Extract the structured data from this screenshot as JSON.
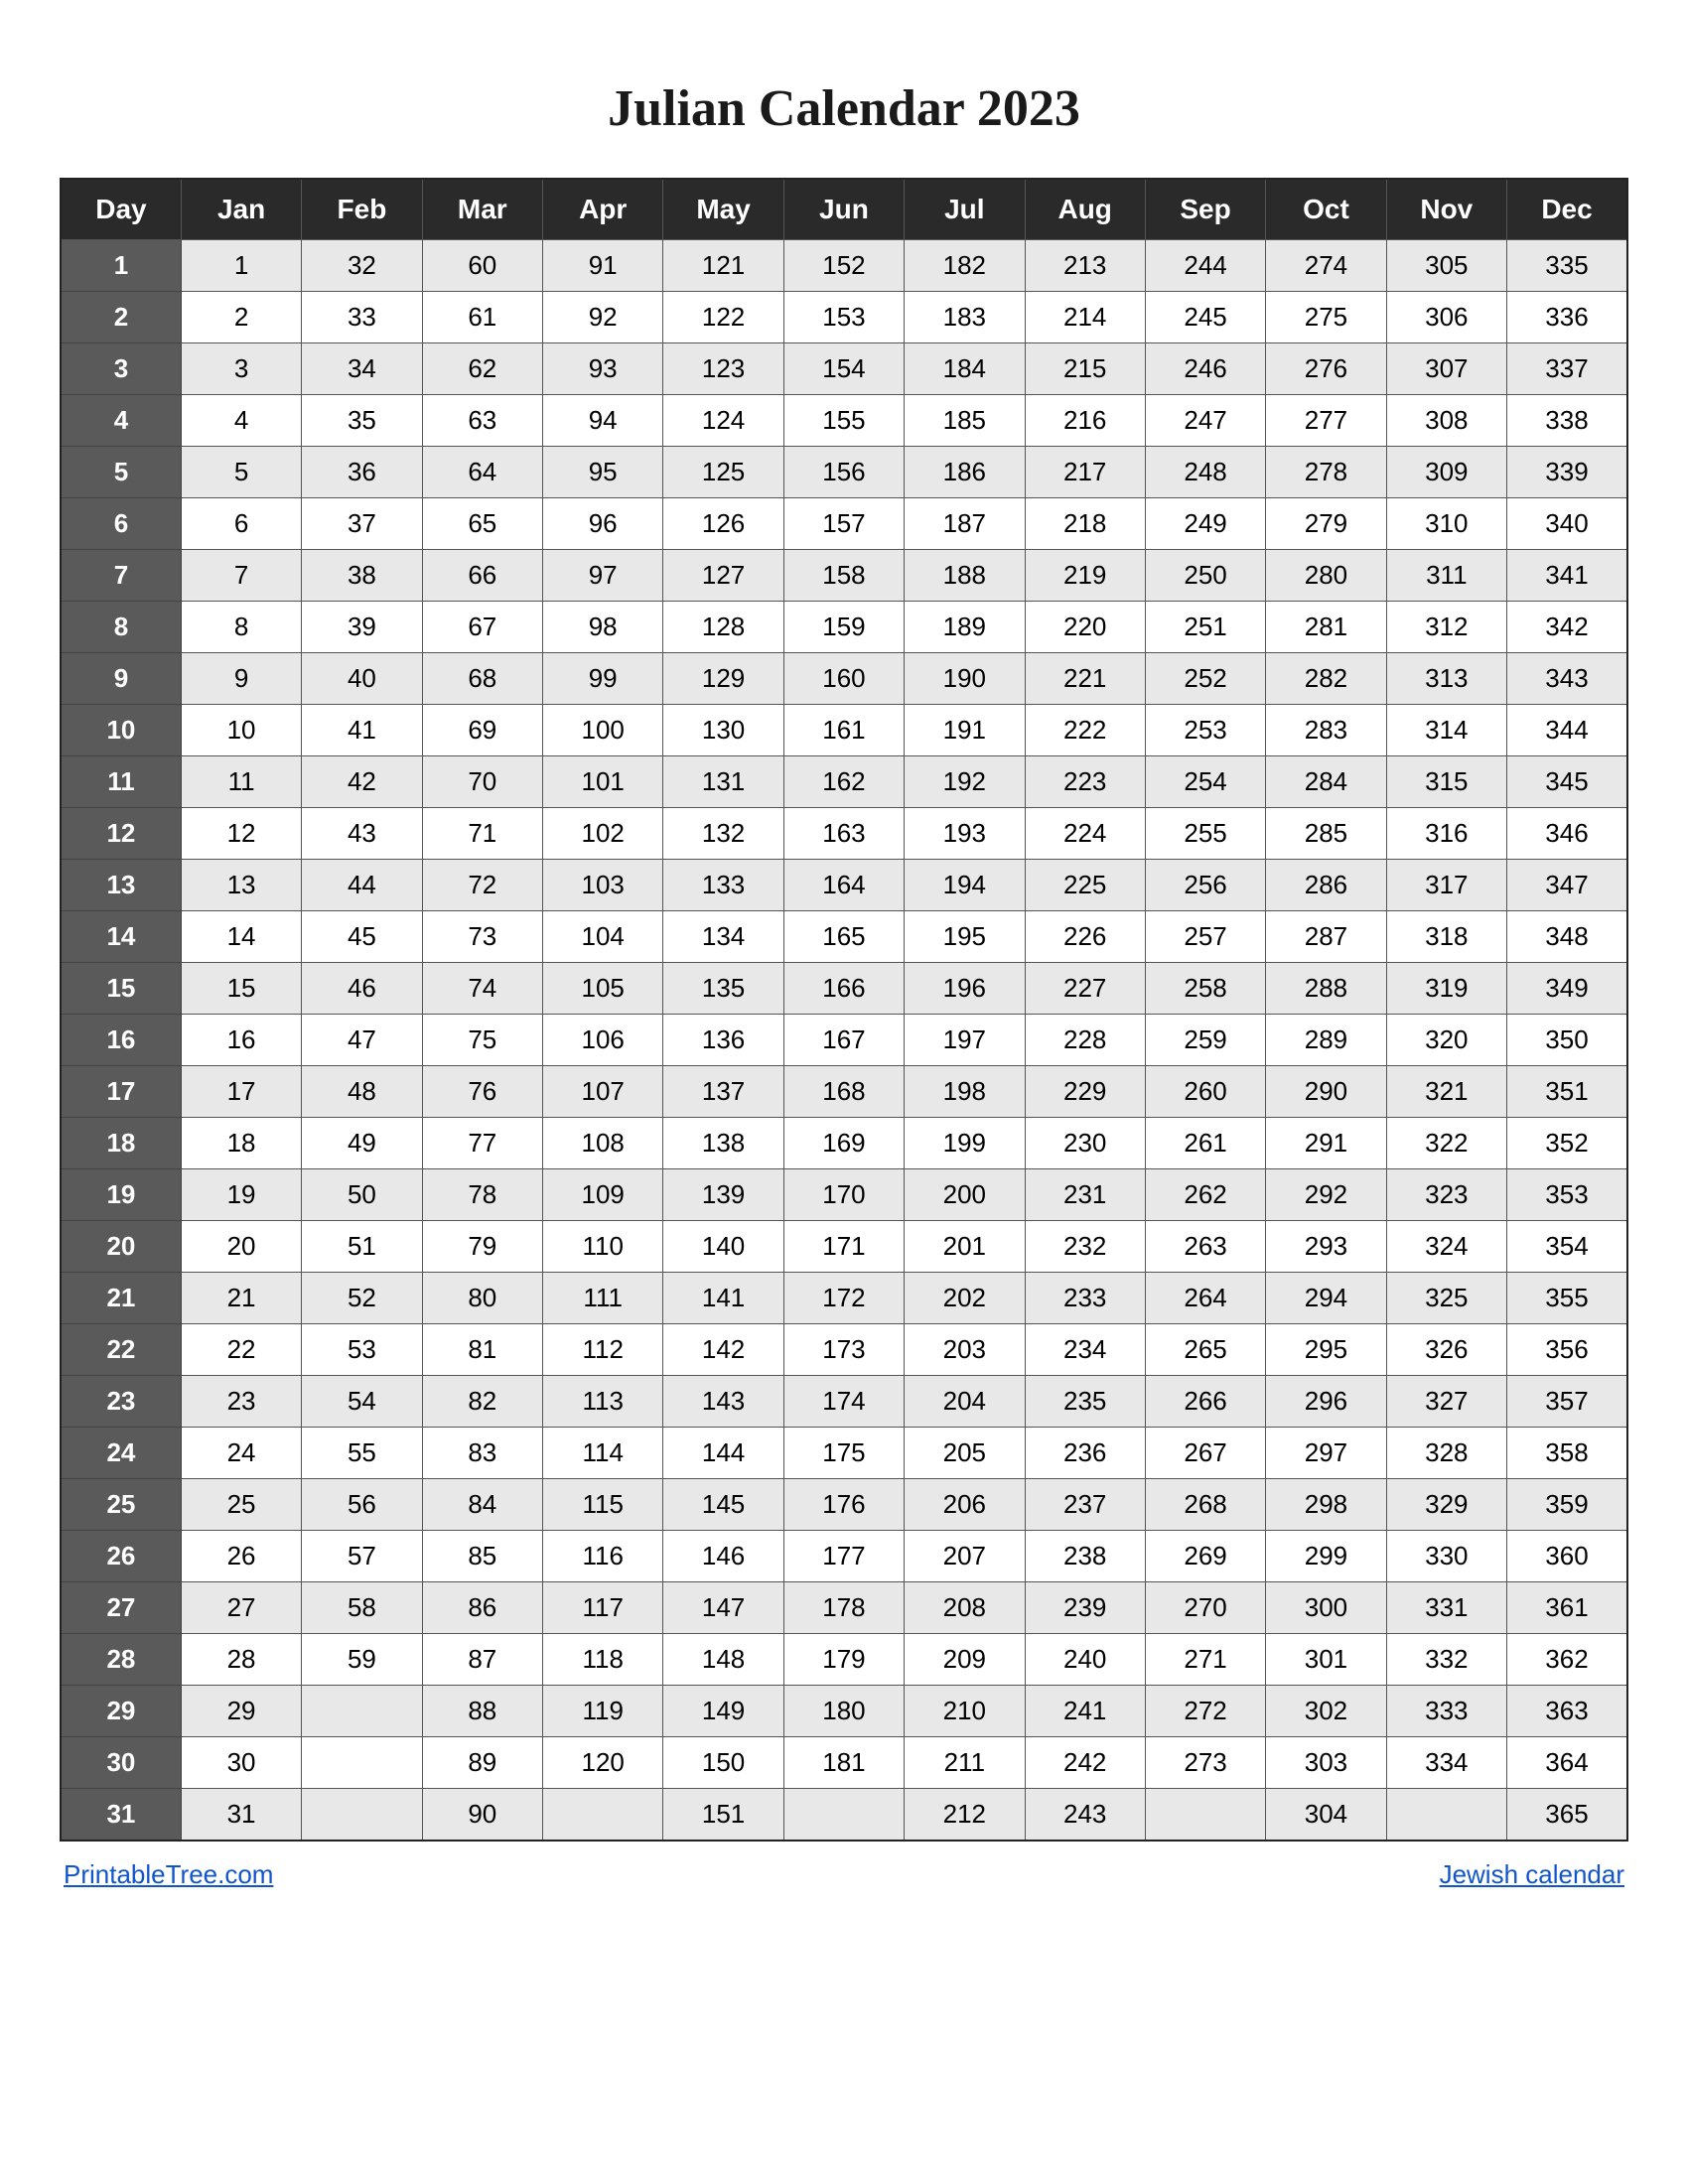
{
  "title": "Julian Calendar 2023",
  "headers": [
    "Day",
    "Jan",
    "Feb",
    "Mar",
    "Apr",
    "May",
    "Jun",
    "Jul",
    "Aug",
    "Sep",
    "Oct",
    "Nov",
    "Dec"
  ],
  "rows": [
    [
      1,
      1,
      32,
      60,
      91,
      121,
      152,
      182,
      213,
      244,
      274,
      305,
      335
    ],
    [
      2,
      2,
      33,
      61,
      92,
      122,
      153,
      183,
      214,
      245,
      275,
      306,
      336
    ],
    [
      3,
      3,
      34,
      62,
      93,
      123,
      154,
      184,
      215,
      246,
      276,
      307,
      337
    ],
    [
      4,
      4,
      35,
      63,
      94,
      124,
      155,
      185,
      216,
      247,
      277,
      308,
      338
    ],
    [
      5,
      5,
      36,
      64,
      95,
      125,
      156,
      186,
      217,
      248,
      278,
      309,
      339
    ],
    [
      6,
      6,
      37,
      65,
      96,
      126,
      157,
      187,
      218,
      249,
      279,
      310,
      340
    ],
    [
      7,
      7,
      38,
      66,
      97,
      127,
      158,
      188,
      219,
      250,
      280,
      311,
      341
    ],
    [
      8,
      8,
      39,
      67,
      98,
      128,
      159,
      189,
      220,
      251,
      281,
      312,
      342
    ],
    [
      9,
      9,
      40,
      68,
      99,
      129,
      160,
      190,
      221,
      252,
      282,
      313,
      343
    ],
    [
      10,
      10,
      41,
      69,
      100,
      130,
      161,
      191,
      222,
      253,
      283,
      314,
      344
    ],
    [
      11,
      11,
      42,
      70,
      101,
      131,
      162,
      192,
      223,
      254,
      284,
      315,
      345
    ],
    [
      12,
      12,
      43,
      71,
      102,
      132,
      163,
      193,
      224,
      255,
      285,
      316,
      346
    ],
    [
      13,
      13,
      44,
      72,
      103,
      133,
      164,
      194,
      225,
      256,
      286,
      317,
      347
    ],
    [
      14,
      14,
      45,
      73,
      104,
      134,
      165,
      195,
      226,
      257,
      287,
      318,
      348
    ],
    [
      15,
      15,
      46,
      74,
      105,
      135,
      166,
      196,
      227,
      258,
      288,
      319,
      349
    ],
    [
      16,
      16,
      47,
      75,
      106,
      136,
      167,
      197,
      228,
      259,
      289,
      320,
      350
    ],
    [
      17,
      17,
      48,
      76,
      107,
      137,
      168,
      198,
      229,
      260,
      290,
      321,
      351
    ],
    [
      18,
      18,
      49,
      77,
      108,
      138,
      169,
      199,
      230,
      261,
      291,
      322,
      352
    ],
    [
      19,
      19,
      50,
      78,
      109,
      139,
      170,
      200,
      231,
      262,
      292,
      323,
      353
    ],
    [
      20,
      20,
      51,
      79,
      110,
      140,
      171,
      201,
      232,
      263,
      293,
      324,
      354
    ],
    [
      21,
      21,
      52,
      80,
      111,
      141,
      172,
      202,
      233,
      264,
      294,
      325,
      355
    ],
    [
      22,
      22,
      53,
      81,
      112,
      142,
      173,
      203,
      234,
      265,
      295,
      326,
      356
    ],
    [
      23,
      23,
      54,
      82,
      113,
      143,
      174,
      204,
      235,
      266,
      296,
      327,
      357
    ],
    [
      24,
      24,
      55,
      83,
      114,
      144,
      175,
      205,
      236,
      267,
      297,
      328,
      358
    ],
    [
      25,
      25,
      56,
      84,
      115,
      145,
      176,
      206,
      237,
      268,
      298,
      329,
      359
    ],
    [
      26,
      26,
      57,
      85,
      116,
      146,
      177,
      207,
      238,
      269,
      299,
      330,
      360
    ],
    [
      27,
      27,
      58,
      86,
      117,
      147,
      178,
      208,
      239,
      270,
      300,
      331,
      361
    ],
    [
      28,
      28,
      59,
      87,
      118,
      148,
      179,
      209,
      240,
      271,
      301,
      332,
      362
    ],
    [
      29,
      29,
      "",
      88,
      119,
      149,
      180,
      210,
      241,
      272,
      302,
      333,
      363
    ],
    [
      30,
      30,
      "",
      89,
      120,
      150,
      181,
      211,
      242,
      273,
      303,
      334,
      364
    ],
    [
      31,
      31,
      "",
      90,
      "",
      151,
      "",
      212,
      243,
      "",
      304,
      "",
      365
    ]
  ],
  "footer": {
    "left_link_text": "PrintableTree.com",
    "left_link_url": "#",
    "right_link_text": "Jewish calendar",
    "right_link_url": "#"
  }
}
